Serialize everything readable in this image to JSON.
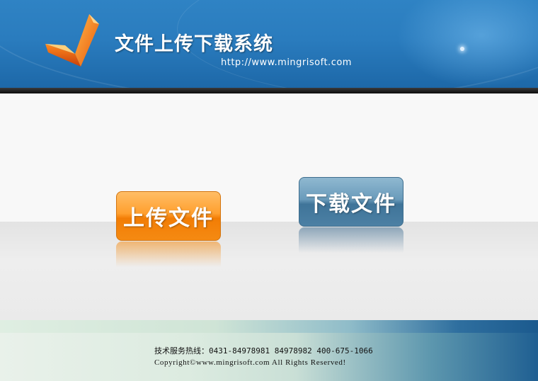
{
  "header": {
    "title": "文件上传下载系统",
    "url": "http://www.mingrisoft.com"
  },
  "main": {
    "upload_button": "上传文件",
    "download_button": "下载文件"
  },
  "footer": {
    "hotline": "技术服务热线：0431-84978981  84978982  400-675-1066",
    "copyright": "Copyright©www.mingrisoft.com All Rights Reserved!"
  },
  "colors": {
    "banner_blue": "#2a7cbe",
    "upload_orange": "#f58a12",
    "download_blue": "#4c80a4",
    "footer_dark_blue": "#1f5f92"
  },
  "icons": {
    "logo": "orange-chevron-logo-icon"
  }
}
